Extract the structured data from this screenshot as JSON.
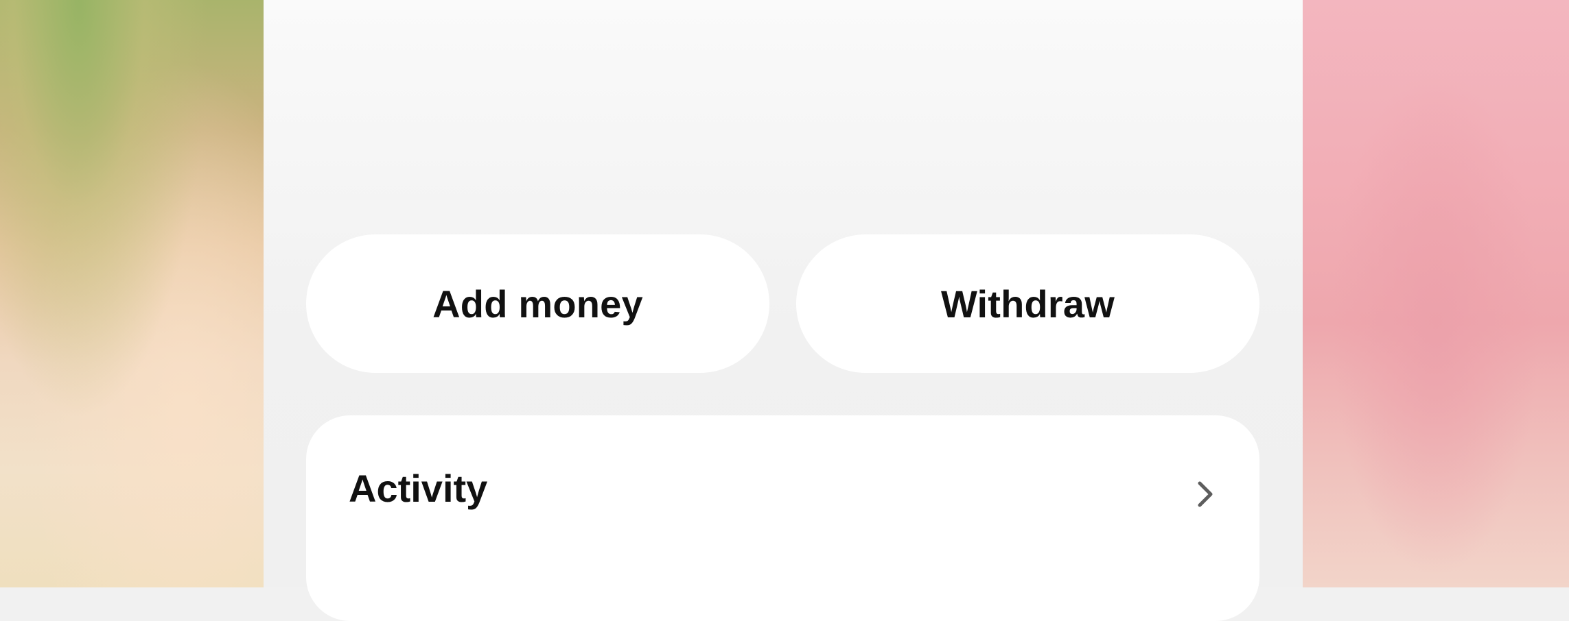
{
  "actions": {
    "add_money_label": "Add money",
    "withdraw_label": "Withdraw"
  },
  "activity": {
    "title": "Activity",
    "icon": "chevron-right-icon"
  }
}
